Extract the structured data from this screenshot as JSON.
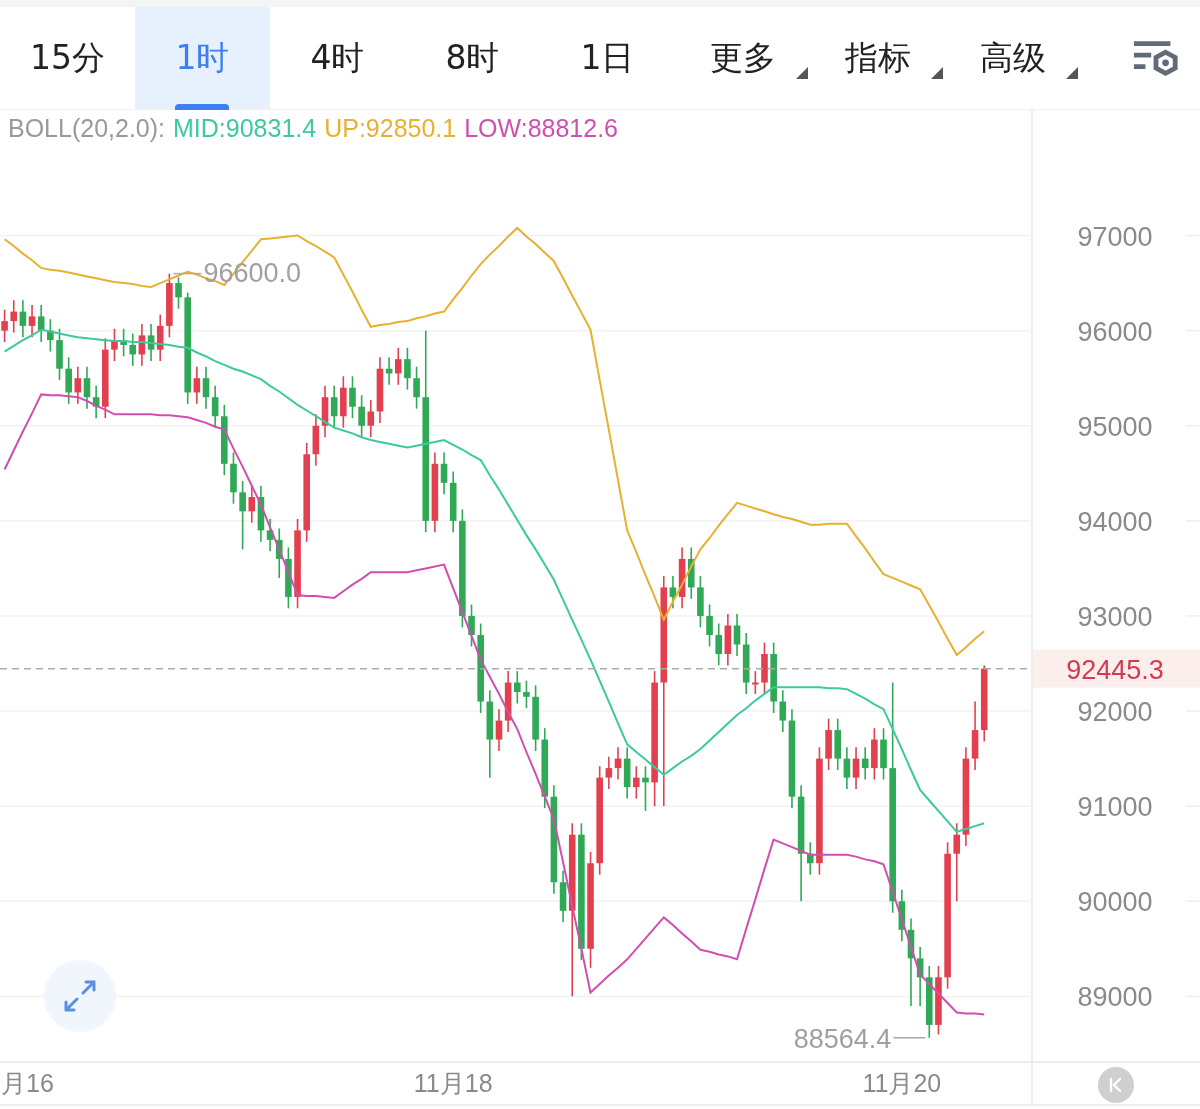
{
  "tabs": [
    {
      "label": "15分",
      "kind": "plain",
      "selected": false
    },
    {
      "label": "1时",
      "kind": "plain",
      "selected": true
    },
    {
      "label": "4时",
      "kind": "plain",
      "selected": false
    },
    {
      "label": "8时",
      "kind": "plain",
      "selected": false
    },
    {
      "label": "1日",
      "kind": "plain",
      "selected": false
    },
    {
      "label": "更多",
      "kind": "dropdown",
      "selected": false
    },
    {
      "label": "指标",
      "kind": "dropdown",
      "selected": false
    },
    {
      "label": "高级",
      "kind": "dropdown",
      "selected": false
    }
  ],
  "legend": {
    "label": "BOLL(20,2.0):",
    "values": [
      ":90831.4",
      ":92850.1",
      ":88812.6"
    ]
  },
  "chart_data": {
    "type": "candlestick",
    "categories": [
      null,
      null,
      "月16",
      null,
      null,
      null,
      null,
      null,
      null,
      null,
      null,
      null,
      null,
      null,
      null,
      null,
      null,
      null,
      null,
      null,
      null,
      null,
      null,
      null,
      null,
      null,
      null,
      null,
      null,
      null,
      null,
      null,
      null,
      null,
      null,
      null,
      null,
      null,
      null,
      null,
      null,
      null,
      null,
      null,
      null,
      null,
      null,
      null,
      null,
      "11月18",
      null,
      null,
      null,
      null,
      null,
      null,
      null,
      null,
      null,
      null,
      null,
      null,
      null,
      null,
      null,
      null,
      null,
      null,
      null,
      null,
      null,
      null,
      null,
      null,
      null,
      null,
      null,
      null,
      null,
      null,
      null,
      null,
      null,
      null,
      null,
      null,
      null,
      null,
      null,
      null,
      null,
      null,
      null,
      null,
      null,
      null,
      null,
      null,
      "11月20",
      null,
      null,
      null,
      null,
      null,
      null,
      null,
      null,
      null
    ],
    "ohlc": [
      [
        96000,
        96220,
        95880,
        96100
      ],
      [
        96100,
        96320,
        95980,
        96200
      ],
      [
        96200,
        96320,
        95930,
        96050
      ],
      [
        96050,
        96270,
        95930,
        96150
      ],
      [
        96150,
        96270,
        95880,
        96000
      ],
      [
        96000,
        96120,
        95780,
        95900
      ],
      [
        95900,
        96020,
        95480,
        95600
      ],
      [
        95600,
        95720,
        95230,
        95350
      ],
      [
        95350,
        95620,
        95230,
        95500
      ],
      [
        95500,
        95620,
        95180,
        95300
      ],
      [
        95300,
        95420,
        95080,
        95200
      ],
      [
        95200,
        95920,
        95080,
        95800
      ],
      [
        95800,
        96020,
        95680,
        95900
      ],
      [
        95900,
        96020,
        95730,
        95850
      ],
      [
        95850,
        95970,
        95630,
        95750
      ],
      [
        95750,
        96070,
        95630,
        95950
      ],
      [
        95950,
        96070,
        95680,
        95800
      ],
      [
        95800,
        96170,
        95680,
        96050
      ],
      [
        96050,
        96600,
        95930,
        96500
      ],
      [
        96500,
        96560,
        96230,
        96350
      ],
      [
        96350,
        96400,
        95230,
        95350
      ],
      [
        95350,
        95620,
        95230,
        95500
      ],
      [
        95500,
        95620,
        95180,
        95300
      ],
      [
        95300,
        95420,
        94980,
        95100
      ],
      [
        95100,
        95220,
        94480,
        94600
      ],
      [
        94600,
        94720,
        94180,
        94300
      ],
      [
        94300,
        94420,
        93700,
        94100
      ],
      [
        94100,
        94370,
        93980,
        94250
      ],
      [
        94250,
        94370,
        93780,
        93900
      ],
      [
        93900,
        94020,
        93680,
        93800
      ],
      [
        93800,
        93920,
        93400,
        93600
      ],
      [
        93600,
        93720,
        93080,
        93200
      ],
      [
        93200,
        94020,
        93080,
        93900
      ],
      [
        93900,
        94820,
        93780,
        94700
      ],
      [
        94700,
        95120,
        94580,
        95000
      ],
      [
        95000,
        95420,
        94880,
        95300
      ],
      [
        95300,
        95420,
        94980,
        95100
      ],
      [
        95100,
        95520,
        94980,
        95400
      ],
      [
        95400,
        95520,
        95080,
        95200
      ],
      [
        95200,
        95320,
        94880,
        95000
      ],
      [
        95000,
        95270,
        94880,
        95150
      ],
      [
        95150,
        95720,
        95030,
        95600
      ],
      [
        95600,
        95720,
        95430,
        95550
      ],
      [
        95550,
        95820,
        95430,
        95700
      ],
      [
        95700,
        95820,
        95380,
        95500
      ],
      [
        95500,
        95620,
        95180,
        95300
      ],
      [
        95300,
        96000,
        93880,
        94000
      ],
      [
        94000,
        94720,
        93880,
        94600
      ],
      [
        94600,
        94720,
        94280,
        94400
      ],
      [
        94400,
        94520,
        93880,
        94000
      ],
      [
        94000,
        94120,
        92880,
        93000
      ],
      [
        93000,
        93120,
        92680,
        92800
      ],
      [
        92800,
        92920,
        91980,
        92100
      ],
      [
        92100,
        92220,
        91300,
        91700
      ],
      [
        91700,
        92020,
        91580,
        91900
      ],
      [
        91900,
        92420,
        91780,
        92300
      ],
      [
        92300,
        92420,
        92080,
        92200
      ],
      [
        92200,
        92320,
        92030,
        92150
      ],
      [
        92150,
        92270,
        91580,
        91700
      ],
      [
        91700,
        91820,
        90980,
        91100
      ],
      [
        91100,
        91220,
        90080,
        90200
      ],
      [
        90200,
        90320,
        89780,
        89900
      ],
      [
        89900,
        90820,
        89000,
        90700
      ],
      [
        90700,
        90820,
        89380,
        89500
      ],
      [
        89500,
        90520,
        89300,
        90400
      ],
      [
        90400,
        91420,
        90280,
        91300
      ],
      [
        91300,
        91520,
        91180,
        91400
      ],
      [
        91400,
        91620,
        91280,
        91500
      ],
      [
        91500,
        91620,
        91080,
        91200
      ],
      [
        91200,
        91420,
        91080,
        91300
      ],
      [
        91300,
        91420,
        90950,
        91250
      ],
      [
        91250,
        92420,
        91000,
        92300
      ],
      [
        92300,
        93420,
        91000,
        93300
      ],
      [
        93300,
        93420,
        93080,
        93200
      ],
      [
        93200,
        93720,
        93080,
        93600
      ],
      [
        93600,
        93720,
        93180,
        93300
      ],
      [
        93300,
        93420,
        92880,
        93000
      ],
      [
        93000,
        93120,
        92680,
        92800
      ],
      [
        92800,
        92920,
        92480,
        92600
      ],
      [
        92600,
        93020,
        92480,
        92900
      ],
      [
        92900,
        93020,
        92580,
        92700
      ],
      [
        92700,
        92820,
        92180,
        92300
      ],
      [
        92300,
        92420,
        92180,
        92300
      ],
      [
        92300,
        92720,
        92180,
        92600
      ],
      [
        92600,
        92720,
        91980,
        92100
      ],
      [
        92100,
        92220,
        91780,
        91900
      ],
      [
        91900,
        92020,
        90980,
        91100
      ],
      [
        91100,
        91220,
        90000,
        90500
      ],
      [
        90500,
        90620,
        90280,
        90400
      ],
      [
        90400,
        91620,
        90280,
        91500
      ],
      [
        91500,
        91920,
        91380,
        91800
      ],
      [
        91800,
        91920,
        91380,
        91500
      ],
      [
        91500,
        91620,
        91180,
        91300
      ],
      [
        91300,
        91620,
        91180,
        91500
      ],
      [
        91500,
        91620,
        91280,
        91400
      ],
      [
        91400,
        91820,
        91280,
        91700
      ],
      [
        91700,
        91820,
        91280,
        91400
      ],
      [
        91400,
        92300,
        89880,
        90000
      ],
      [
        90000,
        90120,
        89580,
        89700
      ],
      [
        89700,
        89820,
        88900,
        89400
      ],
      [
        89400,
        89520,
        88900,
        89200
      ],
      [
        89200,
        89320,
        88564.4,
        88700
      ],
      [
        88700,
        89320,
        88600,
        89200
      ],
      [
        89200,
        90620,
        89080,
        90500
      ],
      [
        90500,
        90820,
        90000,
        90700
      ],
      [
        90700,
        91620,
        90580,
        91500
      ],
      [
        91500,
        92100,
        91380,
        91800
      ],
      [
        91800,
        92480,
        91680,
        92445.3
      ]
    ],
    "series": [
      {
        "name": "MID",
        "type": "line",
        "color": "#3cc9a0",
        "values": [
          95780,
          95840,
          95900,
          95950,
          96010,
          95990,
          95970,
          95950,
          95930,
          95920,
          95910,
          95900,
          95890,
          95890,
          95880,
          95880,
          95870,
          95860,
          95850,
          95830,
          95820,
          95770,
          95730,
          95680,
          95640,
          95600,
          95570,
          95530,
          95490,
          95420,
          95360,
          95290,
          95220,
          95160,
          95100,
          95040,
          94980,
          94950,
          94920,
          94880,
          94850,
          94830,
          94810,
          94790,
          94770,
          94790,
          94810,
          94830,
          94850,
          94800,
          94750,
          94690,
          94640,
          94480,
          94330,
          94170,
          94010,
          93850,
          93700,
          93540,
          93380,
          93170,
          92960,
          92750,
          92540,
          92320,
          92100,
          91870,
          91650,
          91570,
          91490,
          91410,
          91330,
          91400,
          91470,
          91530,
          91600,
          91690,
          91780,
          91870,
          91960,
          92030,
          92110,
          92180,
          92250,
          92250,
          92250,
          92250,
          92250,
          92250,
          92240,
          92240,
          92230,
          92180,
          92130,
          92070,
          92020,
          91810,
          91600,
          91380,
          91170,
          91060,
          90950,
          90840,
          90730,
          90760,
          90790,
          90820
        ]
      },
      {
        "name": "UP",
        "type": "line",
        "color": "#e8b030",
        "values": [
          96960,
          96890,
          96810,
          96740,
          96660,
          96640,
          96630,
          96610,
          96590,
          96570,
          96550,
          96530,
          96510,
          96500,
          96490,
          96470,
          96460,
          96500,
          96540,
          96580,
          96620,
          96590,
          96550,
          96520,
          96480,
          96600,
          96720,
          96840,
          96960,
          96970,
          96980,
          96990,
          97000,
          96940,
          96890,
          96830,
          96770,
          96590,
          96410,
          96220,
          96040,
          96060,
          96070,
          96090,
          96100,
          96130,
          96150,
          96180,
          96200,
          96330,
          96450,
          96580,
          96700,
          96800,
          96890,
          96990,
          97080,
          96990,
          96910,
          96820,
          96730,
          96550,
          96370,
          96190,
          96010,
          95480,
          94960,
          94430,
          93900,
          93670,
          93430,
          93200,
          92960,
          93150,
          93330,
          93520,
          93700,
          93820,
          93950,
          94070,
          94190,
          94160,
          94130,
          94100,
          94070,
          94040,
          94020,
          93990,
          93960,
          93960,
          93970,
          93970,
          93970,
          93840,
          93710,
          93570,
          93440,
          93400,
          93360,
          93320,
          93280,
          93110,
          92940,
          92760,
          92590,
          92670,
          92760,
          92840
        ]
      },
      {
        "name": "LOW",
        "type": "line",
        "color": "#d04fae",
        "values": [
          94540,
          94740,
          94940,
          95130,
          95330,
          95320,
          95320,
          95310,
          95300,
          95260,
          95210,
          95170,
          95120,
          95120,
          95120,
          95120,
          95120,
          95110,
          95110,
          95100,
          95090,
          95060,
          95030,
          94990,
          94960,
          94760,
          94570,
          94370,
          94170,
          93930,
          93700,
          93460,
          93220,
          93210,
          93210,
          93200,
          93190,
          93260,
          93330,
          93390,
          93460,
          93460,
          93460,
          93460,
          93460,
          93480,
          93500,
          93520,
          93540,
          93290,
          93040,
          92790,
          92540,
          92360,
          92180,
          91990,
          91810,
          91570,
          91340,
          91100,
          90860,
          90410,
          89950,
          89500,
          89040,
          89130,
          89220,
          89300,
          89390,
          89500,
          89610,
          89720,
          89830,
          89750,
          89660,
          89580,
          89490,
          89470,
          89440,
          89420,
          89390,
          89710,
          90020,
          90340,
          90650,
          90610,
          90570,
          90530,
          90490,
          90490,
          90490,
          90490,
          90490,
          90470,
          90440,
          90420,
          90390,
          90100,
          89810,
          89520,
          89230,
          89130,
          89030,
          88930,
          88830,
          88820,
          88820,
          88810
        ]
      }
    ],
    "ylim": [
      88310,
      98320
    ],
    "grid": true,
    "yticks": [
      89000,
      90000,
      91000,
      92000,
      93000,
      94000,
      95000,
      96000,
      97000
    ],
    "annotations": [
      "96600.0",
      "88564.4"
    ],
    "ref_lines": [
      {
        "axis": "y",
        "value": 92445.3,
        "label": "92445.3"
      }
    ]
  }
}
